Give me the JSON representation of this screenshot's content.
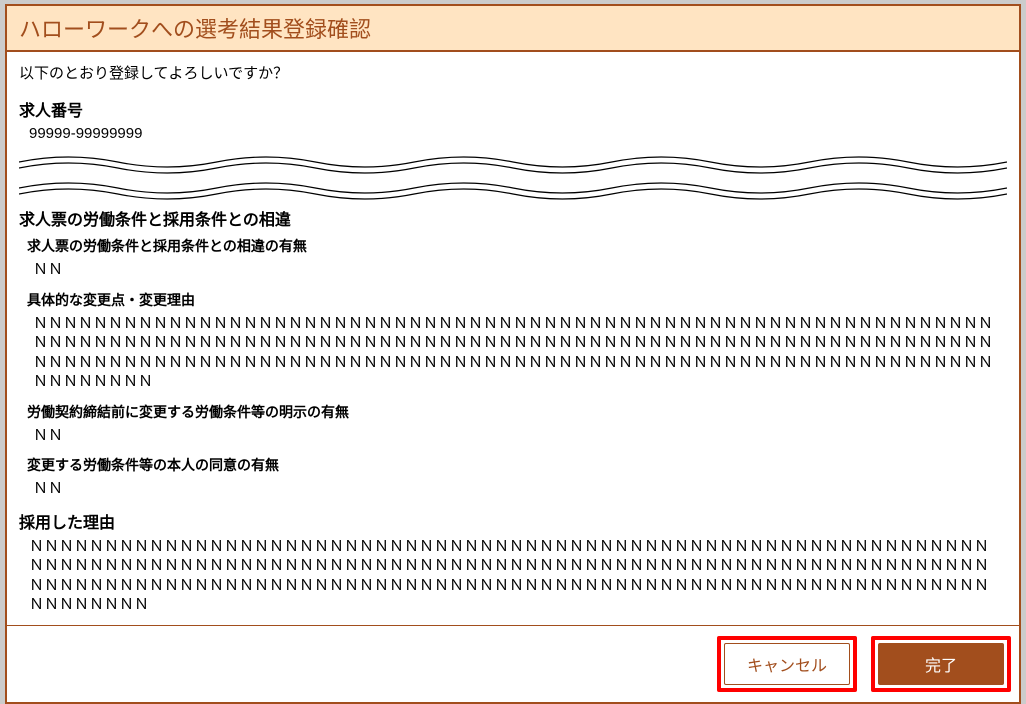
{
  "dialog": {
    "title": "ハローワークへの選考結果登録確認",
    "prompt": "以下のとおり登録してよろしいですか？"
  },
  "job_number": {
    "heading": "求人番号",
    "value": "99999-99999999"
  },
  "diff": {
    "heading": "求人票の労働条件と採用条件との相違",
    "has_diff_label": "求人票の労働条件と採用条件との相違の有無",
    "has_diff_value": "ＮＮ",
    "detail_label": "具体的な変更点・変更理由",
    "detail_value": "ＮＮＮＮＮＮＮＮＮＮＮＮＮＮＮＮＮＮＮＮＮＮＮＮＮＮＮＮＮＮＮＮＮＮＮＮＮＮＮＮＮＮＮＮＮＮＮＮＮＮＮＮＮＮＮＮＮＮＮＮＮＮＮＮＮＮＮＮＮＮＮＮＮＮＮＮＮＮＮＮＮＮＮＮＮＮＮＮＮＮＮＮＮＮＮＮＮＮＮＮＮＮＮＮＮＮＮＮＮＮＮＮＮＮＮＮＮＮＮＮＮＮＮＮＮＮＮＮＮＮＮＮＮＮＮＮＮＮＮＮＮＮＮＮＮＮＮＮＮＮＮＮＮＮＮＮＮＮＮＮＮＮＮＮＮＮＮＮＮＮＮＮＮＮＮＮＮＮＮＮＮＮＮＮＮＮＮＮＮＮＮＮＮＮＮＮＮＮＮＮ",
    "disclosure_label": "労働契約締結前に変更する労働条件等の明示の有無",
    "disclosure_value": "ＮＮ",
    "consent_label": "変更する労働条件等の本人の同意の有無",
    "consent_value": "ＮＮ"
  },
  "reason": {
    "heading": "採用した理由",
    "value": "ＮＮＮＮＮＮＮＮＮＮＮＮＮＮＮＮＮＮＮＮＮＮＮＮＮＮＮＮＮＮＮＮＮＮＮＮＮＮＮＮＮＮＮＮＮＮＮＮＮＮＮＮＮＮＮＮＮＮＮＮＮＮＮＮＮＮＮＮＮＮＮＮＮＮＮＮＮＮＮＮＮＮＮＮＮＮＮＮＮＮＮＮＮＮＮＮＮＮＮＮＮＮＮＮＮＮＮＮＮＮＮＮＮＮＮＮＮＮＮＮＮＮＮＮＮＮＮＮＮＮＮＮＮＮＮＮＮＮＮＮＮＮＮＮＮＮＮＮＮＮＮＮＮＮＮＮＮＮＮＮＮＮＮＮＮＮＮＮＮＮＮＮＮＮＮＮＮＮＮＮＮＮＮＮＮＮＮＮＮＮＮＮＮＮＮＮＮＮＮＮ"
  },
  "buttons": {
    "cancel": "キャンセル",
    "complete": "完了"
  }
}
